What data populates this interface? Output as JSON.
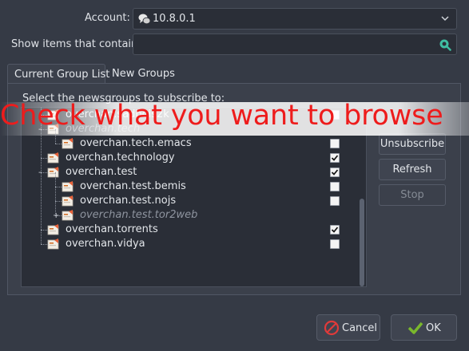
{
  "form": {
    "account_label": "Account:",
    "account_value": "10.8.0.1",
    "search_label": "Show items that contain:",
    "search_value": ""
  },
  "tabs": [
    {
      "label": "Current Group List",
      "active": true
    },
    {
      "label": "New Groups",
      "active": false
    }
  ],
  "panel": {
    "instruction": "Select the newsgroups to subscribe to:"
  },
  "tree": [
    {
      "name": "overchan.sadbois2k",
      "checked": false,
      "italic": false,
      "level": 0
    },
    {
      "name": "overchan.tech",
      "checked": null,
      "italic": true,
      "level": 0
    },
    {
      "name": "overchan.tech.emacs",
      "checked": false,
      "italic": false,
      "level": 1
    },
    {
      "name": "overchan.technology",
      "checked": true,
      "italic": false,
      "level": 0
    },
    {
      "name": "overchan.test",
      "checked": true,
      "italic": false,
      "level": 0
    },
    {
      "name": "overchan.test.bemis",
      "checked": false,
      "italic": false,
      "level": 1
    },
    {
      "name": "overchan.test.nojs",
      "checked": false,
      "italic": false,
      "level": 1
    },
    {
      "name": "overchan.test.tor2web",
      "checked": null,
      "italic": true,
      "level": 1
    },
    {
      "name": "overchan.torrents",
      "checked": true,
      "italic": false,
      "level": 0
    },
    {
      "name": "overchan.vidya",
      "checked": false,
      "italic": false,
      "level": 0
    }
  ],
  "side_buttons": {
    "unsubscribe": "Unsubscribe",
    "refresh": "Refresh",
    "stop": "Stop"
  },
  "overlay_text": "Check what you want to browse",
  "dialog_buttons": {
    "cancel": "Cancel",
    "ok": "OK"
  },
  "colors": {
    "overlay_text": "#ee1c1c",
    "background": "#353a45",
    "ok_check": "#7ab82c",
    "cancel_icon": "#e03a3a",
    "search_icon": "#3fbfa2"
  },
  "icons": {
    "account": "chat-bubbles-icon",
    "dropdown": "chevron-down-icon",
    "search": "search-icon",
    "newsgroup": "newsgroup-icon",
    "cancel": "cancel-icon",
    "ok": "checkmark-icon"
  }
}
